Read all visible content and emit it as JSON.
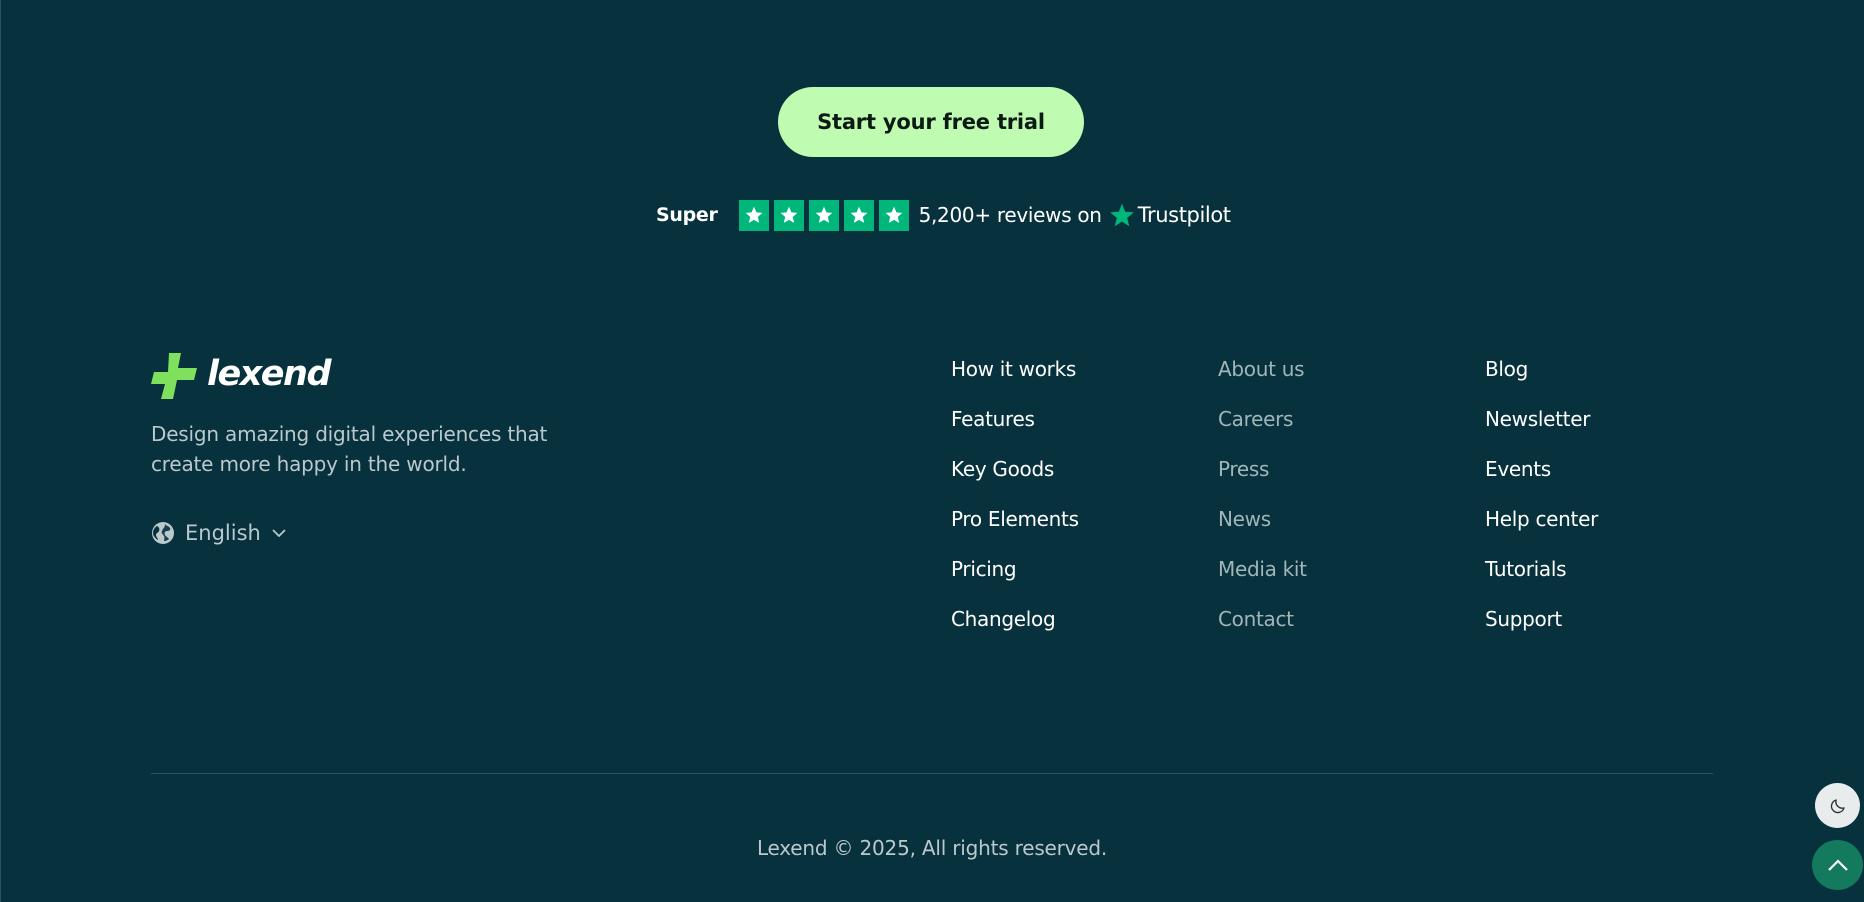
{
  "cta": {
    "label": "Start your free trial"
  },
  "rating": {
    "word": "Super",
    "stars": 5,
    "reviews_text": "5,200+ reviews on",
    "platform": "Trustpilot",
    "star_color": "#00b67a"
  },
  "brand": {
    "name": "lexend",
    "tagline": "Design amazing digital experiences that create more happy in the world.",
    "logo_color": "#7ee05c"
  },
  "language": {
    "selected": "English"
  },
  "footer_columns": [
    {
      "links": [
        "How it works",
        "Features",
        "Key Goods",
        "Pro Elements",
        "Pricing",
        "Changelog"
      ]
    },
    {
      "links": [
        "About us",
        "Careers",
        "Press",
        "News",
        "Media kit",
        "Contact"
      ]
    },
    {
      "links": [
        "Blog",
        "Newsletter",
        "Events",
        "Help center",
        "Tutorials",
        "Support"
      ]
    }
  ],
  "copyright": "Lexend © 2025, All rights reserved.",
  "colors": {
    "background": "#07313c",
    "cta_background": "#c0fbb2",
    "scroll_top_button": "#137a5e",
    "theme_toggle": "#e8ecec"
  },
  "icons": {
    "globe": "globe-icon",
    "chevron": "chevron-down-icon",
    "theme": "moon-icon",
    "scroll_top": "chevron-up-icon"
  }
}
